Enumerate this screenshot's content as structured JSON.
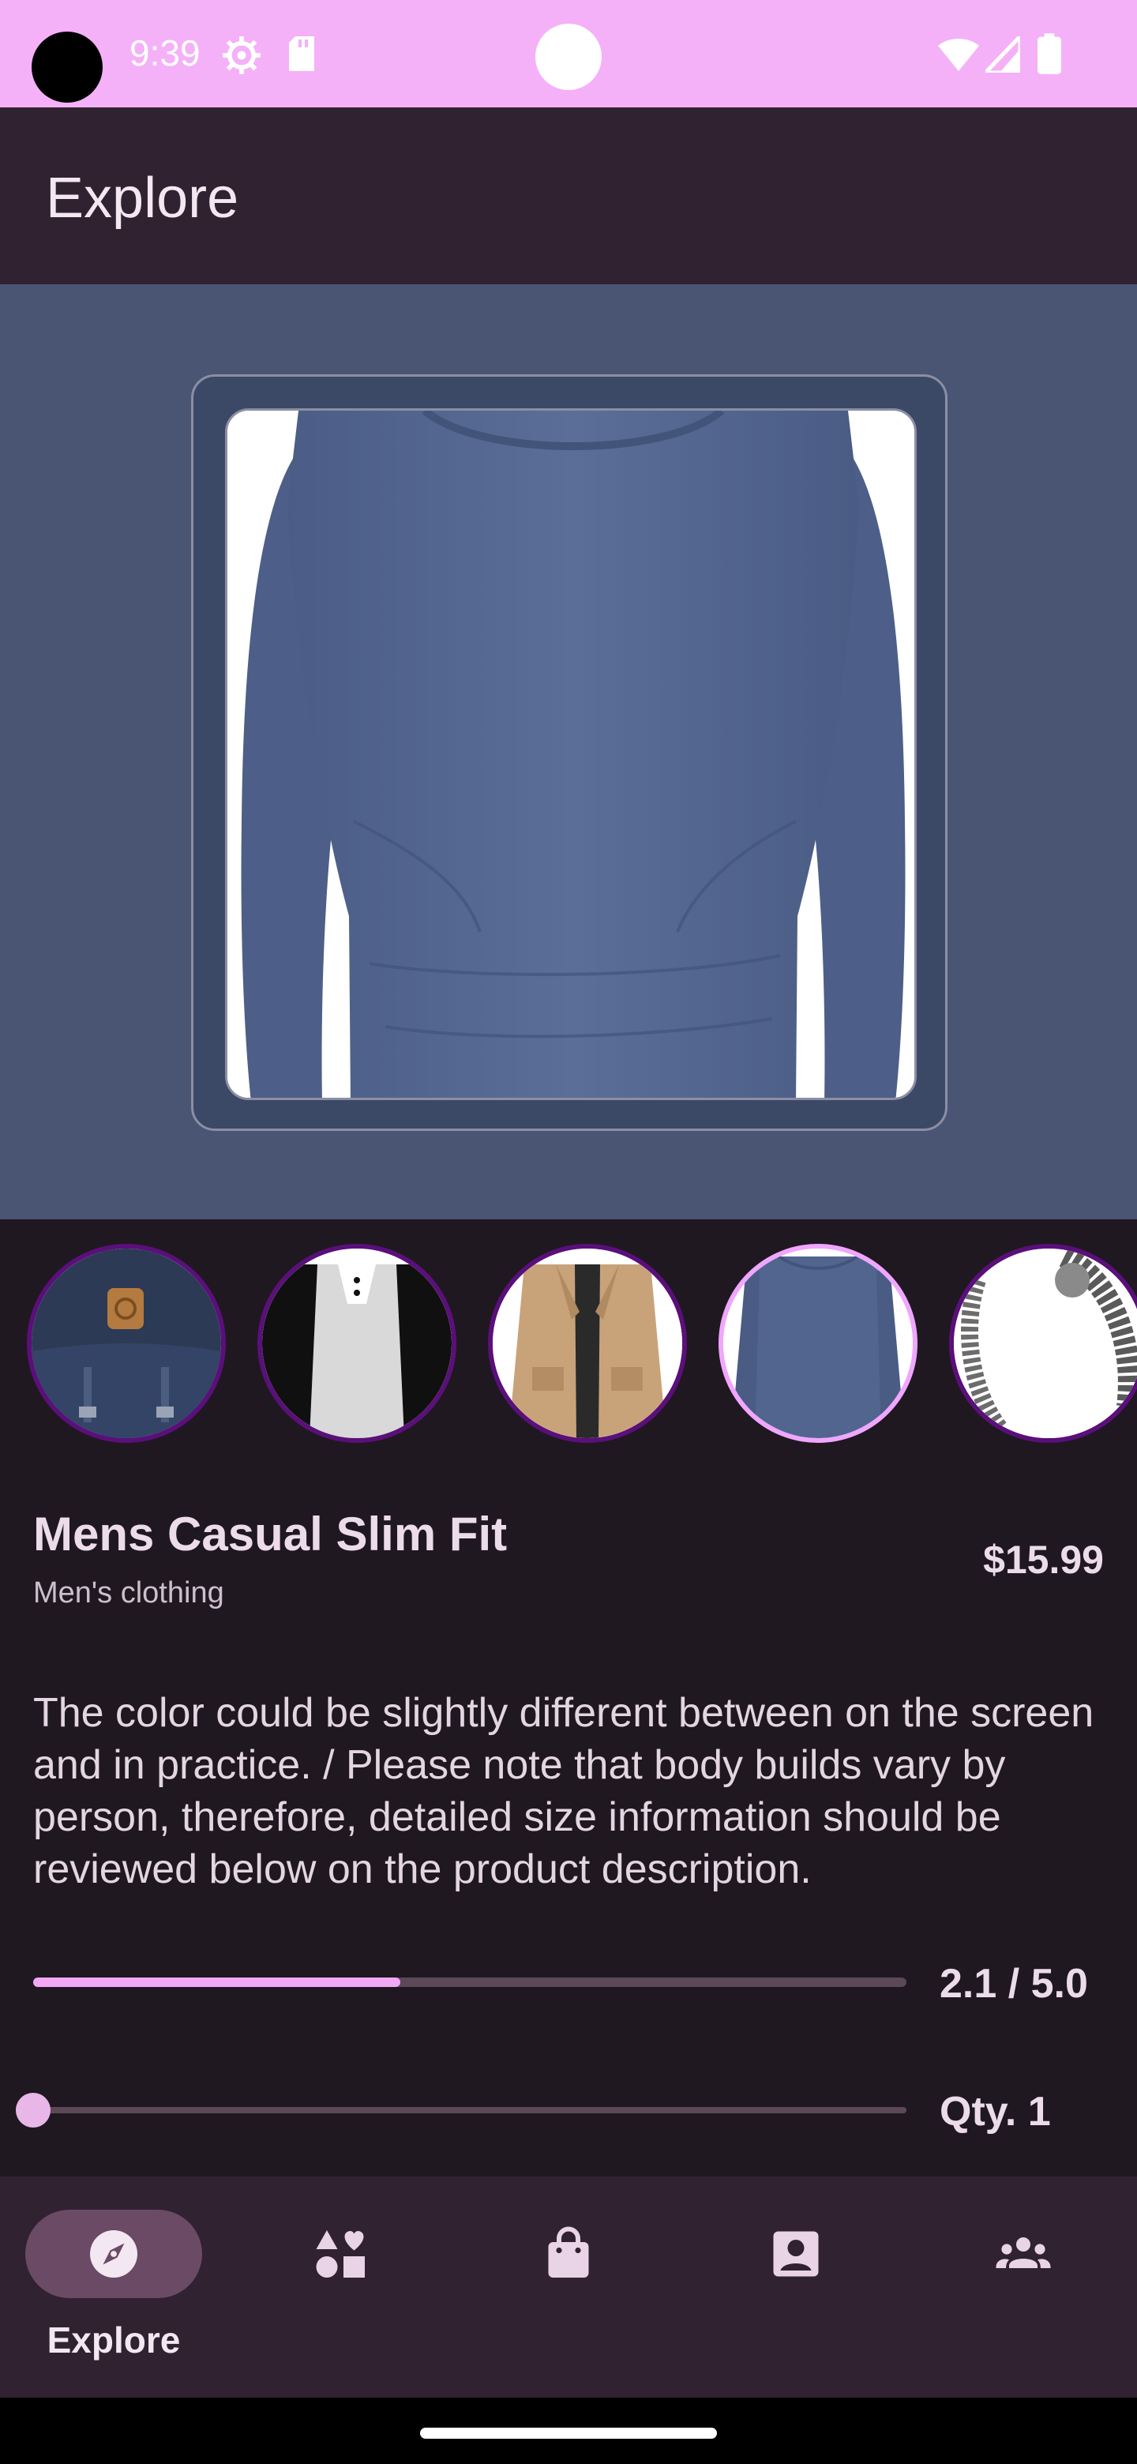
{
  "status_bar": {
    "time": "9:39",
    "background": "#f4b1f8"
  },
  "app_bar": {
    "title": "Explore"
  },
  "product": {
    "title": "Mens Casual Slim Fit",
    "category": "Men's clothing",
    "price": "$15.99",
    "description": "The color could be slightly different between on the screen and in practice. / Please note that body builds vary by person, therefore, detailed size information should be reviewed below on the product description.",
    "rating_text": "2.1 / 5.0",
    "rating_fraction": 0.42,
    "quantity_text": "Qty. 1"
  },
  "thumbnails": [
    {
      "name": "backpack",
      "selected": false
    },
    {
      "name": "raglan-shirt",
      "selected": false
    },
    {
      "name": "jacket",
      "selected": false
    },
    {
      "name": "slim-fit-tshirt",
      "selected": true
    },
    {
      "name": "bracelet",
      "selected": false
    }
  ],
  "bottom_nav": {
    "items": [
      {
        "label": "Explore",
        "icon": "compass-icon",
        "active": true
      },
      {
        "label": "",
        "icon": "categories-icon",
        "active": false
      },
      {
        "label": "",
        "icon": "shopping-bag-icon",
        "active": false
      },
      {
        "label": "",
        "icon": "account-box-icon",
        "active": false
      },
      {
        "label": "",
        "icon": "group-icon",
        "active": false
      }
    ]
  },
  "colors": {
    "accent": "#f2a8f4",
    "hero_background": "#4a5574",
    "surface": "#1f1820",
    "app_bar": "#302230"
  }
}
